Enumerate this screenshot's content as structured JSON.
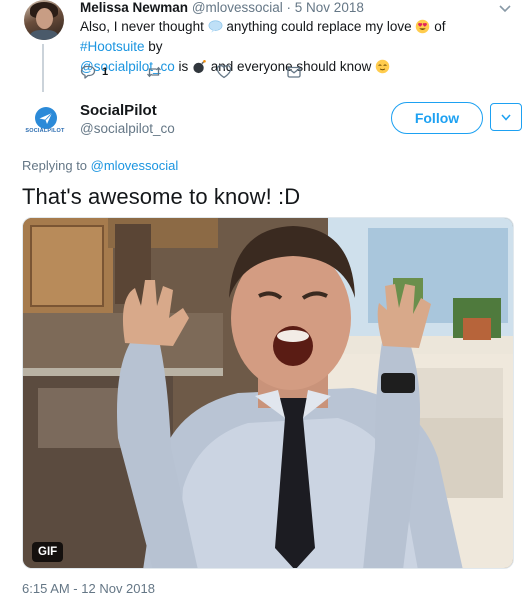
{
  "parent_tweet": {
    "author_name": "Melissa Newman",
    "meta": "@mlovessocial · 5 Nov 2018",
    "text_part1": "Also, I never thought ",
    "text_part2": " anything could replace my love ",
    "text_part3": " of ",
    "hashtag": "#Hootsuite",
    "text_part4": " by",
    "mention": "@socialpilot_co",
    "text_part5": " is ",
    "text_part6": " and everyone should know ",
    "reply_count": "1",
    "icons": [
      "speech-bubble-icon",
      "heart-eyes-emoji-icon",
      "bomb-emoji-icon",
      "relieved-face-emoji-icon",
      "reply-icon",
      "retweet-icon",
      "like-icon",
      "direct-message-icon",
      "chevron-down-icon"
    ]
  },
  "reply_tweet": {
    "author_name": "SocialPilot",
    "handle": "@socialpilot_co",
    "logo_text": "SOCIALPILOT",
    "follow_label": "Follow",
    "replying_prefix": "Replying to ",
    "replying_to": "@mlovessocial",
    "text": "That's awesome to know! :D",
    "media_badge": "GIF",
    "timestamp": "6:15 AM - 12 Nov 2018"
  },
  "colors": {
    "link": "#1b95e0",
    "accent": "#1da1f2",
    "secondary_text": "#657786",
    "primary_text": "#14171a"
  }
}
